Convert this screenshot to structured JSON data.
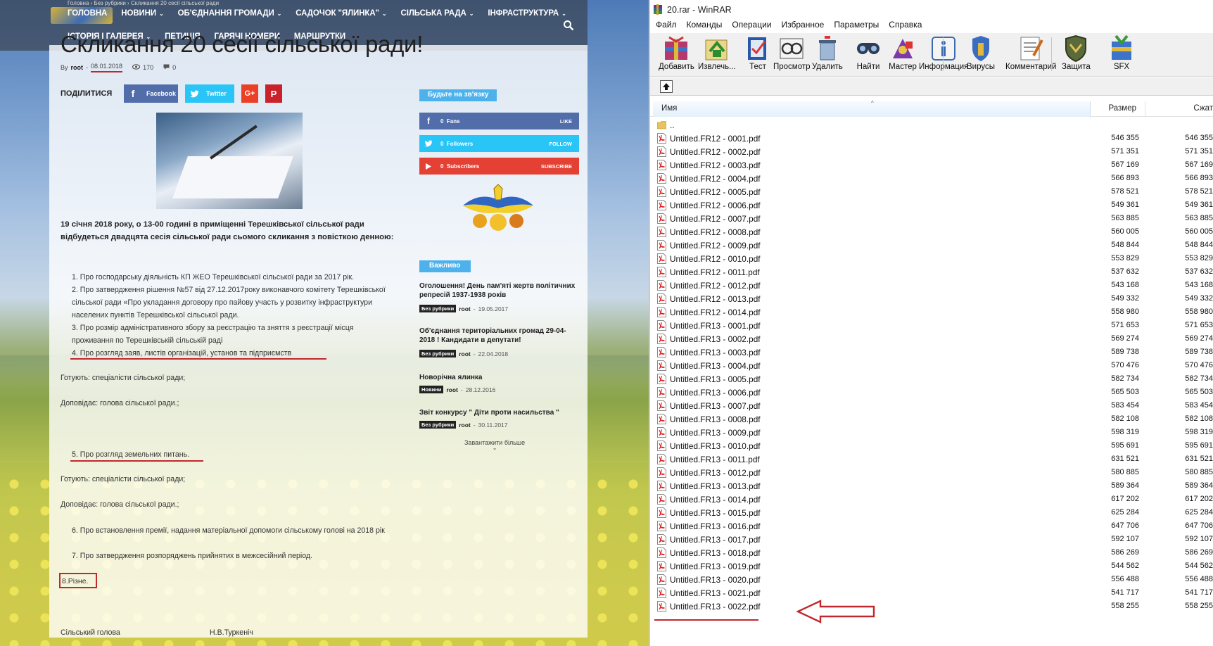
{
  "site": {
    "breadcrumb": "Головна › Без рубрики › Скликання 20 сесії сільської ради",
    "nav": [
      {
        "label": "ГОЛОВНА",
        "caret": false
      },
      {
        "label": "НОВИНИ",
        "caret": true
      },
      {
        "label": "ОБ'ЄДНАННЯ ГРОМАДИ",
        "caret": true
      },
      {
        "label": "САДОЧОК \"ЯЛИНКА\"",
        "caret": true
      },
      {
        "label": "СІЛЬСЬКА РАДА",
        "caret": true
      },
      {
        "label": "ІНФРАСТРУКТУРА",
        "caret": true
      }
    ],
    "nav2": [
      {
        "label": "ІСТОРІЯ І ГАЛЕРЕЯ",
        "caret": true
      },
      {
        "label": "ПЕТИЦІЯ",
        "caret": false
      },
      {
        "label": "ГАРЯЧІ НОМЕРИ",
        "caret": false
      },
      {
        "label": "МАРШРУТКИ",
        "caret": false
      }
    ],
    "caret_glyph": "⌄",
    "article": {
      "title": "Скликання 20 сесії сільської ради!",
      "by": "By",
      "author": "root",
      "sep": "-",
      "date": "08.01.2018",
      "views": "170",
      "comments": "0",
      "share_label": "ПОДІЛИТИСЯ",
      "share_facebook": "Facebook",
      "share_twitter": "Twitter",
      "share_gplus": "G+",
      "share_pinterest": "P",
      "lead": "19 січня 2018 року, о 13-00 годині в приміщенні Терешківської сільської ради відбудеться двадцята сесія сільської ради  сьомого скликання з повісткою денною:",
      "agenda_1": "1. Про господарську діяльність КП ЖЕО Терешківської сільської ради за 2017 рік.",
      "agenda_2": "2. Про затвердження рішення №57 від 27.12.2017року виконавчого комітету Терешківської сільської ради «Про укладання договору про пайову участь у розвитку  інфраструктури населених пунктів Терешківської сільської ради.",
      "agenda_3": "3. Про розмір адміністративного збору за реєстрацію та зняття з реєстрації місця проживання по Терешківській сільській раді",
      "agenda_4": "4. Про розгляд заяв, листів  організацій, установ та підприємств",
      "prep_1": "Готують: спеціалісти  сільської  ради;",
      "report_1": "Доповідає: голова сільської ради.;",
      "agenda_5": "5. Про розгляд земельних питань.",
      "prep_2": "Готують: спеціалісти  сільської  ради;",
      "report_2": "Доповідає: голова сільської ради.;",
      "agenda_6": "6. Про  встановлення  премії, надання матеріальної допомоги сільському голові на 2018 рік",
      "agenda_7": "7. Про затвердження розпоряджень прийнятих в межсесійний період.",
      "agenda_8": "8.Різне.",
      "sig_title": "Сільський голова",
      "sig_name": "Н.В.Туркеніч"
    },
    "sidebar": {
      "contact_title": "Будьте на зв'язку",
      "facebook_count": "0",
      "facebook_unit": "Fans",
      "facebook_action": "LIKE",
      "twitter_count": "0",
      "twitter_unit": "Followers",
      "twitter_action": "FOLLOW",
      "youtube_count": "0",
      "youtube_unit": "Subscribers",
      "youtube_action": "SUBSCRIBE",
      "important_title": "Важливо",
      "news": [
        {
          "title": "Оголошення! День пам'яті жертв політичних репресій 1937-1938 років",
          "category": "Без рубрики",
          "author": "root",
          "date": "19.05.2017"
        },
        {
          "title": "Об'єднання територіальних громад 29-04-2018 ! Кандидати в депутати!",
          "category": "Без рубрики",
          "author": "root",
          "date": "22.04.2018"
        },
        {
          "title": "Новорічна ялинка",
          "category": "Новини",
          "author": "root",
          "date": "28.12.2016"
        },
        {
          "title": "Звіт конкурсу \" Діти проти насильства \"",
          "category": "Без рубрики",
          "author": "root",
          "date": "30.11.2017"
        }
      ],
      "load_more": "Завантажити більше"
    }
  },
  "winrar": {
    "title": "20.rar - WinRAR",
    "menu": [
      "Файл",
      "Команды",
      "Операции",
      "Избранное",
      "Параметры",
      "Справка"
    ],
    "toolbar": [
      "Добавить",
      "Извлечь...",
      "Тест",
      "Просмотр",
      "Удалить",
      "Найти",
      "Мастер",
      "Информация",
      "Вирусы",
      "Комментарий",
      "Защита",
      "SFX"
    ],
    "columns": {
      "name": "Имя",
      "size": "Размер",
      "packed": "Сжат"
    },
    "parent_dir": "..",
    "files": [
      {
        "name": "Untitled.FR12 - 0001.pdf",
        "size": "546 355",
        "packed": "546 355"
      },
      {
        "name": "Untitled.FR12 - 0002.pdf",
        "size": "571 351",
        "packed": "571 351"
      },
      {
        "name": "Untitled.FR12 - 0003.pdf",
        "size": "567 169",
        "packed": "567 169"
      },
      {
        "name": "Untitled.FR12 - 0004.pdf",
        "size": "566 893",
        "packed": "566 893"
      },
      {
        "name": "Untitled.FR12 - 0005.pdf",
        "size": "578 521",
        "packed": "578 521"
      },
      {
        "name": "Untitled.FR12 - 0006.pdf",
        "size": "549 361",
        "packed": "549 361"
      },
      {
        "name": "Untitled.FR12 - 0007.pdf",
        "size": "563 885",
        "packed": "563 885"
      },
      {
        "name": "Untitled.FR12 - 0008.pdf",
        "size": "560 005",
        "packed": "560 005"
      },
      {
        "name": "Untitled.FR12 - 0009.pdf",
        "size": "548 844",
        "packed": "548 844"
      },
      {
        "name": "Untitled.FR12 - 0010.pdf",
        "size": "553 829",
        "packed": "553 829"
      },
      {
        "name": "Untitled.FR12 - 0011.pdf",
        "size": "537 632",
        "packed": "537 632"
      },
      {
        "name": "Untitled.FR12 - 0012.pdf",
        "size": "543 168",
        "packed": "543 168"
      },
      {
        "name": "Untitled.FR12 - 0013.pdf",
        "size": "549 332",
        "packed": "549 332"
      },
      {
        "name": "Untitled.FR12 - 0014.pdf",
        "size": "558 980",
        "packed": "558 980"
      },
      {
        "name": "Untitled.FR13 - 0001.pdf",
        "size": "571 653",
        "packed": "571 653"
      },
      {
        "name": "Untitled.FR13 - 0002.pdf",
        "size": "569 274",
        "packed": "569 274"
      },
      {
        "name": "Untitled.FR13 - 0003.pdf",
        "size": "589 738",
        "packed": "589 738"
      },
      {
        "name": "Untitled.FR13 - 0004.pdf",
        "size": "570 476",
        "packed": "570 476"
      },
      {
        "name": "Untitled.FR13 - 0005.pdf",
        "size": "582 734",
        "packed": "582 734"
      },
      {
        "name": "Untitled.FR13 - 0006.pdf",
        "size": "565 503",
        "packed": "565 503"
      },
      {
        "name": "Untitled.FR13 - 0007.pdf",
        "size": "583 454",
        "packed": "583 454"
      },
      {
        "name": "Untitled.FR13 - 0008.pdf",
        "size": "582 108",
        "packed": "582 108"
      },
      {
        "name": "Untitled.FR13 - 0009.pdf",
        "size": "598 319",
        "packed": "598 319"
      },
      {
        "name": "Untitled.FR13 - 0010.pdf",
        "size": "595 691",
        "packed": "595 691"
      },
      {
        "name": "Untitled.FR13 - 0011.pdf",
        "size": "631 521",
        "packed": "631 521"
      },
      {
        "name": "Untitled.FR13 - 0012.pdf",
        "size": "580 885",
        "packed": "580 885"
      },
      {
        "name": "Untitled.FR13 - 0013.pdf",
        "size": "589 364",
        "packed": "589 364"
      },
      {
        "name": "Untitled.FR13 - 0014.pdf",
        "size": "617 202",
        "packed": "617 202"
      },
      {
        "name": "Untitled.FR13 - 0015.pdf",
        "size": "625 284",
        "packed": "625 284"
      },
      {
        "name": "Untitled.FR13 - 0016.pdf",
        "size": "647 706",
        "packed": "647 706"
      },
      {
        "name": "Untitled.FR13 - 0017.pdf",
        "size": "592 107",
        "packed": "592 107"
      },
      {
        "name": "Untitled.FR13 - 0018.pdf",
        "size": "586 269",
        "packed": "586 269"
      },
      {
        "name": "Untitled.FR13 - 0019.pdf",
        "size": "544 562",
        "packed": "544 562"
      },
      {
        "name": "Untitled.FR13 - 0020.pdf",
        "size": "556 488",
        "packed": "556 488"
      },
      {
        "name": "Untitled.FR13 - 0021.pdf",
        "size": "541 717",
        "packed": "541 717"
      },
      {
        "name": "Untitled.FR13 - 0022.pdf",
        "size": "558 255",
        "packed": "558 255"
      }
    ]
  },
  "colors": {
    "annotation_red": "#c0282d",
    "sidebar_accent": "#4db2ec",
    "facebook": "#516eab",
    "twitter": "#29c5f6",
    "youtube": "#e44134"
  }
}
